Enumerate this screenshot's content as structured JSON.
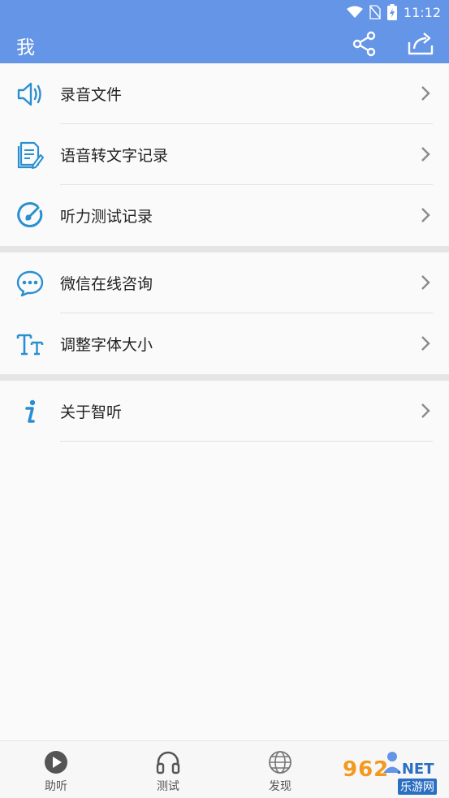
{
  "status_bar": {
    "time": "11:12"
  },
  "app_bar": {
    "title": "我"
  },
  "menu_groups": [
    {
      "items": [
        {
          "label": "录音文件",
          "icon": "speaker-icon"
        },
        {
          "label": "语音转文字记录",
          "icon": "document-edit-icon"
        },
        {
          "label": "听力测试记录",
          "icon": "gauge-icon"
        }
      ]
    },
    {
      "items": [
        {
          "label": "微信在线咨询",
          "icon": "chat-bubble-icon"
        },
        {
          "label": "调整字体大小",
          "icon": "font-size-icon"
        }
      ]
    },
    {
      "items": [
        {
          "label": "关于智听",
          "icon": "info-icon"
        }
      ]
    }
  ],
  "tabs": [
    {
      "label": "助听",
      "icon": "play-circle-icon"
    },
    {
      "label": "测试",
      "icon": "headphones-icon"
    },
    {
      "label": "发现",
      "icon": "globe-icon"
    }
  ],
  "watermark": {
    "text": "962",
    "net": ".NET",
    "sub": "乐游网"
  },
  "colors": {
    "primary": "#6495e6",
    "icon_blue": "#2a8fd0"
  }
}
